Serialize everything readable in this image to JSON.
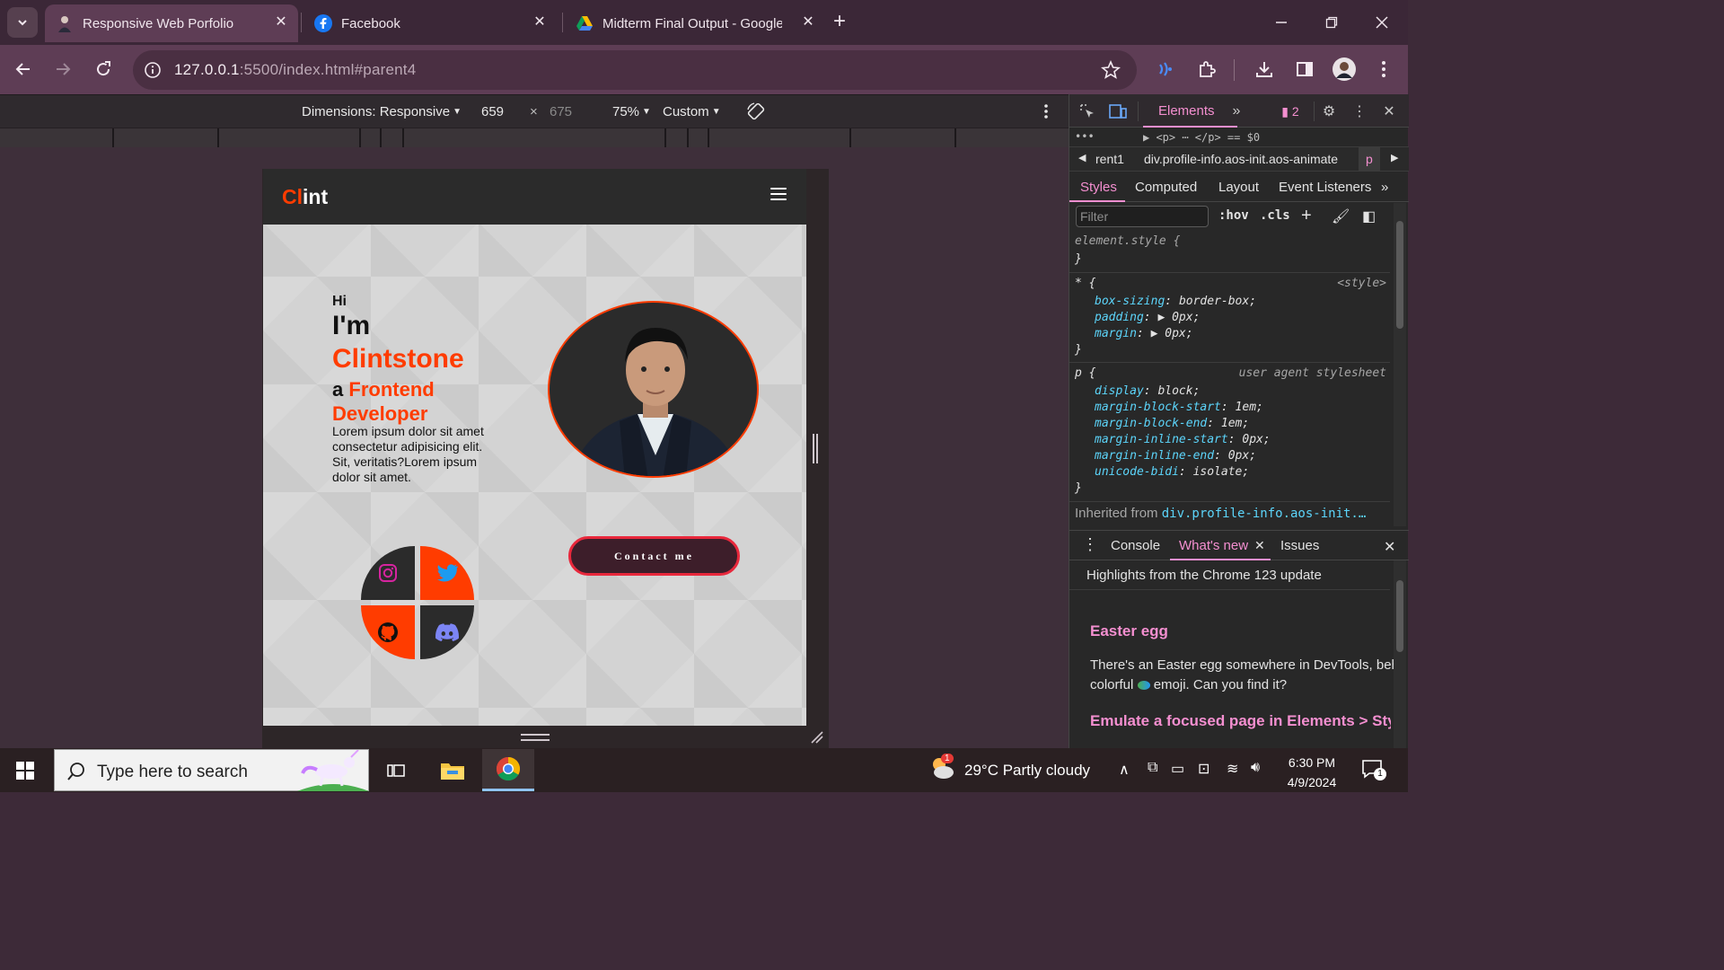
{
  "browser": {
    "tabs": [
      {
        "title": "Responsive Web Porfolio",
        "active": true
      },
      {
        "title": "Facebook",
        "active": false
      },
      {
        "title": "Midterm Final Output - Google",
        "active": false
      }
    ],
    "url_host": "127.0.0.1",
    "url_path": ":5500/index.html#parent4"
  },
  "device_toolbar": {
    "dimensions_label": "Dimensions: Responsive",
    "width": "659",
    "times": "×",
    "height": "675",
    "zoom": "75%",
    "throttle": "Custom"
  },
  "site": {
    "logo_accent": "Cl",
    "logo_rest": "int",
    "hi": "Hi",
    "im": "I'm",
    "name": "Clintstone",
    "role_prefix": "a",
    "role_word1": "Frontend",
    "role_word2": "Developer",
    "lorem": "Lorem ipsum dolor sit amet consectetur adipisicing elit. Sit, veritatis?Lorem ipsum dolor sit amet.",
    "contact_label": "Contact me",
    "accent_color": "#ff3c00"
  },
  "devtools": {
    "panel_tab": "Elements",
    "issues_count": "2",
    "dom_snippet": "▶ <p> ⋯ </p>  == $0",
    "breadcrumb_left": "rent1",
    "breadcrumb_main": "div.profile-info.aos-init.aos-animate",
    "breadcrumb_right": "p",
    "subtabs": [
      "Styles",
      "Computed",
      "Layout",
      "Event Listeners"
    ],
    "filter_placeholder": "Filter",
    "hov": ":hov",
    "cls": ".cls",
    "styles": {
      "element_style": "element.style {",
      "close": "}",
      "star_selector": "* {",
      "star_source": "<style>",
      "star_props": [
        {
          "name": "box-sizing",
          "value": "border-box;"
        },
        {
          "name": "padding",
          "value": "▶ 0px;"
        },
        {
          "name": "margin",
          "value": "▶ 0px;"
        }
      ],
      "p_selector": "p {",
      "p_source": "user agent stylesheet",
      "p_props": [
        {
          "name": "display",
          "value": "block;"
        },
        {
          "name": "margin-block-start",
          "value": "1em;"
        },
        {
          "name": "margin-block-end",
          "value": "1em;"
        },
        {
          "name": "margin-inline-start",
          "value": "0px;"
        },
        {
          "name": "margin-inline-end",
          "value": "0px;"
        },
        {
          "name": "unicode-bidi",
          "value": "isolate;"
        }
      ],
      "inherited_label": "Inherited from",
      "inherited_class": "div.profile-info.aos-init.…"
    },
    "drawer_tabs": [
      "Console",
      "What's new",
      "Issues"
    ],
    "whats_new_title": "Highlights from the Chrome 123 update",
    "easter_heading": "Easter egg",
    "easter_line1": "There's an Easter egg somewhere in DevTools, behir",
    "easter_line2_a": "colorful",
    "easter_line2_b": "emoji. Can you find it?",
    "emulate_heading": "Emulate a focused page in Elements > Sty"
  },
  "taskbar": {
    "search_placeholder": "Type here to search",
    "weather": "29°C  Partly cloudy",
    "weather_badge": "1",
    "time": "6:30 PM",
    "date": "4/9/2024",
    "notif_count": "1"
  }
}
